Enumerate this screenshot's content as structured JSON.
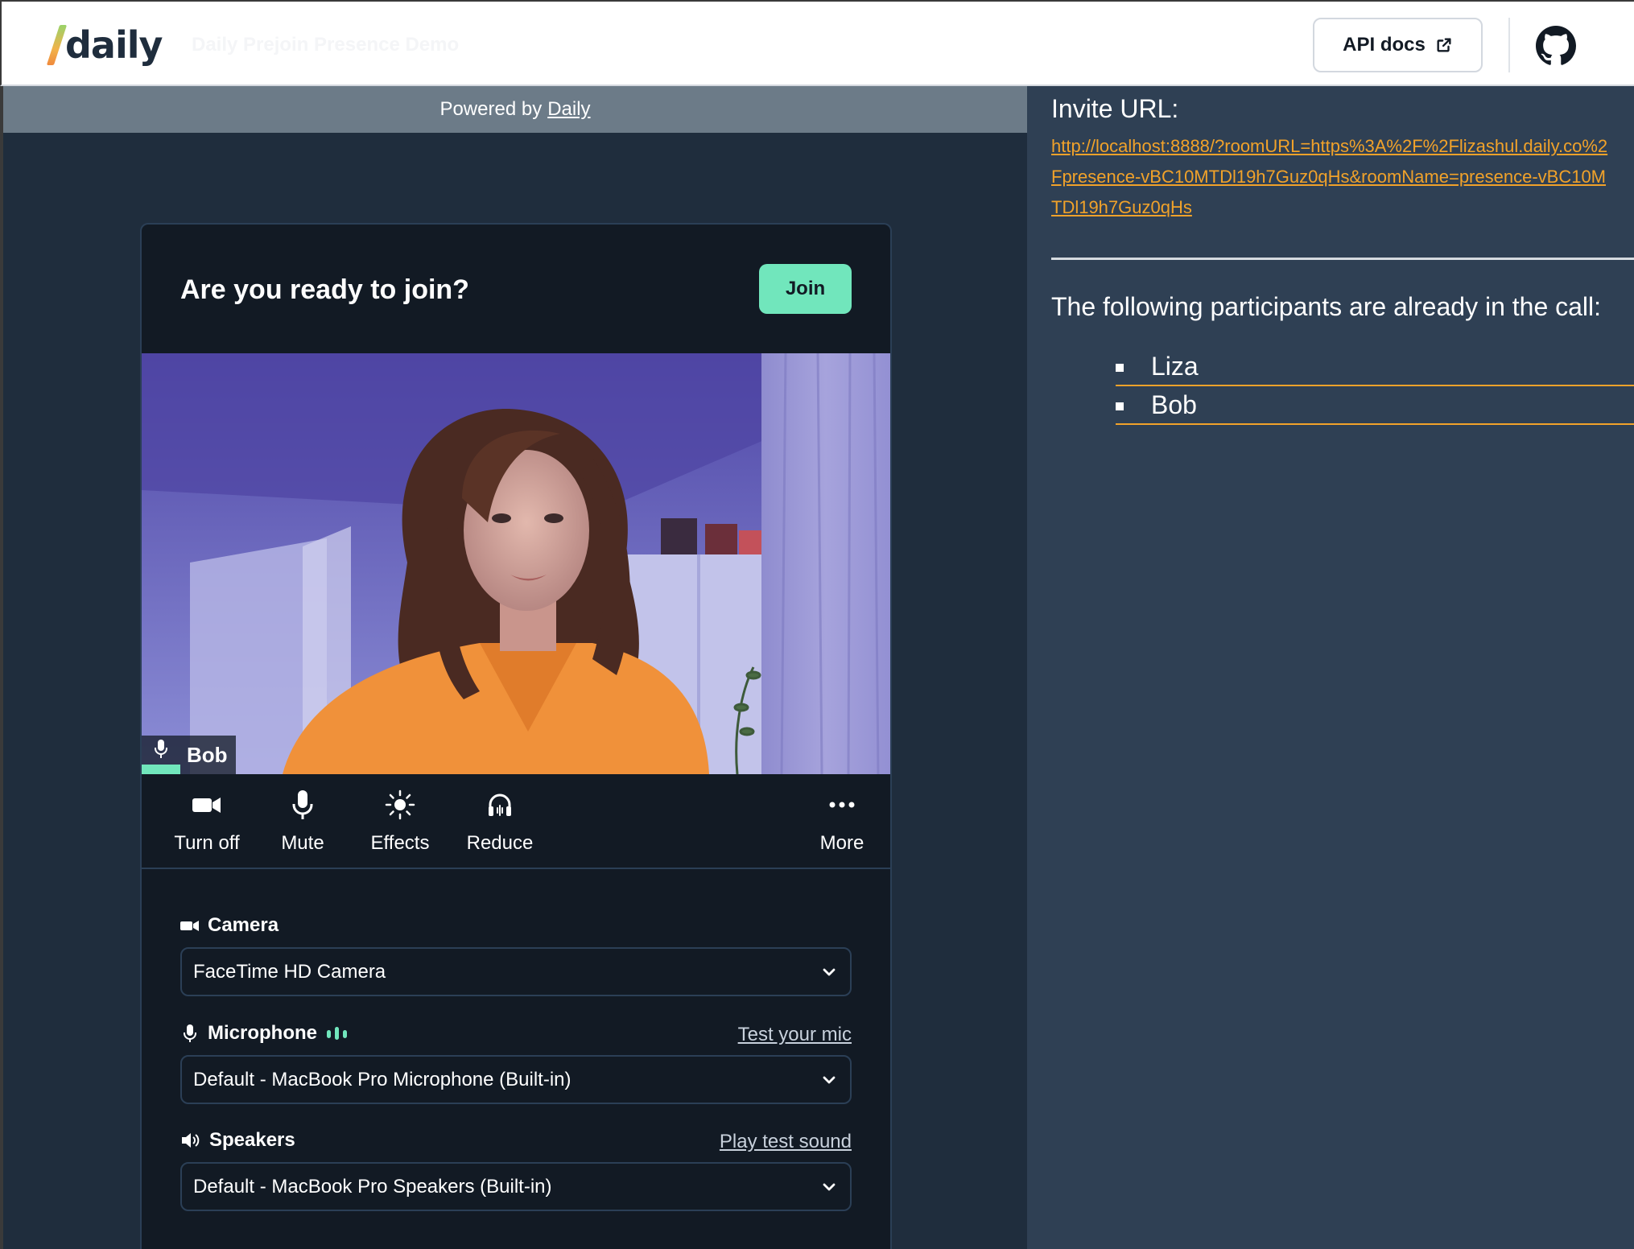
{
  "header": {
    "logo_text": "daily",
    "title": "Daily Prejoin Presence Demo",
    "api_docs_label": "API docs"
  },
  "left": {
    "powered_prefix": "Powered by",
    "powered_link": "Daily"
  },
  "prejoin": {
    "title": "Are you ready to join?",
    "join_label": "Join",
    "video_name": "Bob",
    "controls": {
      "camera_label": "Turn off",
      "mute_label": "Mute",
      "effects_label": "Effects",
      "reduce_label": "Reduce",
      "more_label": "More"
    },
    "camera": {
      "label": "Camera",
      "value": "FaceTime HD Camera"
    },
    "microphone": {
      "label": "Microphone",
      "link": "Test your mic",
      "value": "Default - MacBook Pro Microphone (Built-in)"
    },
    "speakers": {
      "label": "Speakers",
      "link": "Play test sound",
      "value": "Default - MacBook Pro Speakers (Built-in)"
    }
  },
  "right": {
    "invite_title": "Invite URL:",
    "invite_url": "http://localhost:8888/?roomURL=https%3A%2F%2Flizashul.daily.co%2Fpresence-vBC10MTDl19h7Guz0qHs&roomName=presence-vBC10MTDl19h7Guz0qHs",
    "participants_title": "The following participants are already in the call:",
    "participants": [
      "Liza",
      "Bob"
    ]
  },
  "colors": {
    "accent": "#71e6bc",
    "link_orange": "#f1a22a",
    "dark_panel": "#121a24",
    "navy": "#1f2d3d",
    "right_bg": "#2f4054"
  }
}
